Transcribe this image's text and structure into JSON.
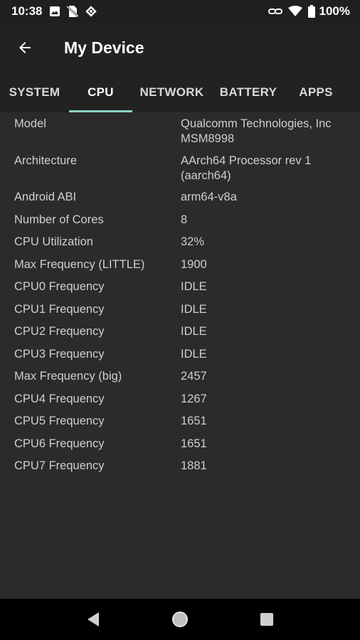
{
  "status_bar": {
    "time": "10:38",
    "battery": "100%",
    "left_icons": [
      "image-icon",
      "no-sim-icon",
      "sync-icon"
    ],
    "right_icons": [
      "link-icon",
      "wifi-icon",
      "battery-icon"
    ]
  },
  "app_bar": {
    "title": "My Device"
  },
  "tabs": [
    {
      "label": "SYSTEM",
      "active": false
    },
    {
      "label": "CPU",
      "active": true
    },
    {
      "label": "NETWORK",
      "active": false
    },
    {
      "label": "BATTERY",
      "active": false
    },
    {
      "label": "APPS",
      "active": false
    }
  ],
  "rows": [
    {
      "label": "Model",
      "value": "Qualcomm Technologies, Inc MSM8998"
    },
    {
      "label": "Architecture",
      "value": "AArch64 Processor rev 1 (aarch64)"
    },
    {
      "label": "Android ABI",
      "value": "arm64-v8a"
    },
    {
      "label": "Number of Cores",
      "value": "8"
    },
    {
      "label": "CPU Utilization",
      "value": "32%"
    },
    {
      "label": "Max Frequency (LITTLE)",
      "value": "1900"
    },
    {
      "label": "CPU0 Frequency",
      "value": "IDLE"
    },
    {
      "label": "CPU1 Frequency",
      "value": "IDLE"
    },
    {
      "label": "CPU2 Frequency",
      "value": "IDLE"
    },
    {
      "label": "CPU3 Frequency",
      "value": "IDLE"
    },
    {
      "label": "Max Frequency (big)",
      "value": "2457"
    },
    {
      "label": "CPU4 Frequency",
      "value": "1267"
    },
    {
      "label": "CPU5 Frequency",
      "value": "1651"
    },
    {
      "label": "CPU6 Frequency",
      "value": "1651"
    },
    {
      "label": "CPU7 Frequency",
      "value": "1881"
    }
  ],
  "colors": {
    "status_bar": "#1f1f1f",
    "app_bar": "#222222",
    "background": "#2b2b2b",
    "tab_indicator": "#8fd3c6",
    "nav_bar": "#000000"
  }
}
